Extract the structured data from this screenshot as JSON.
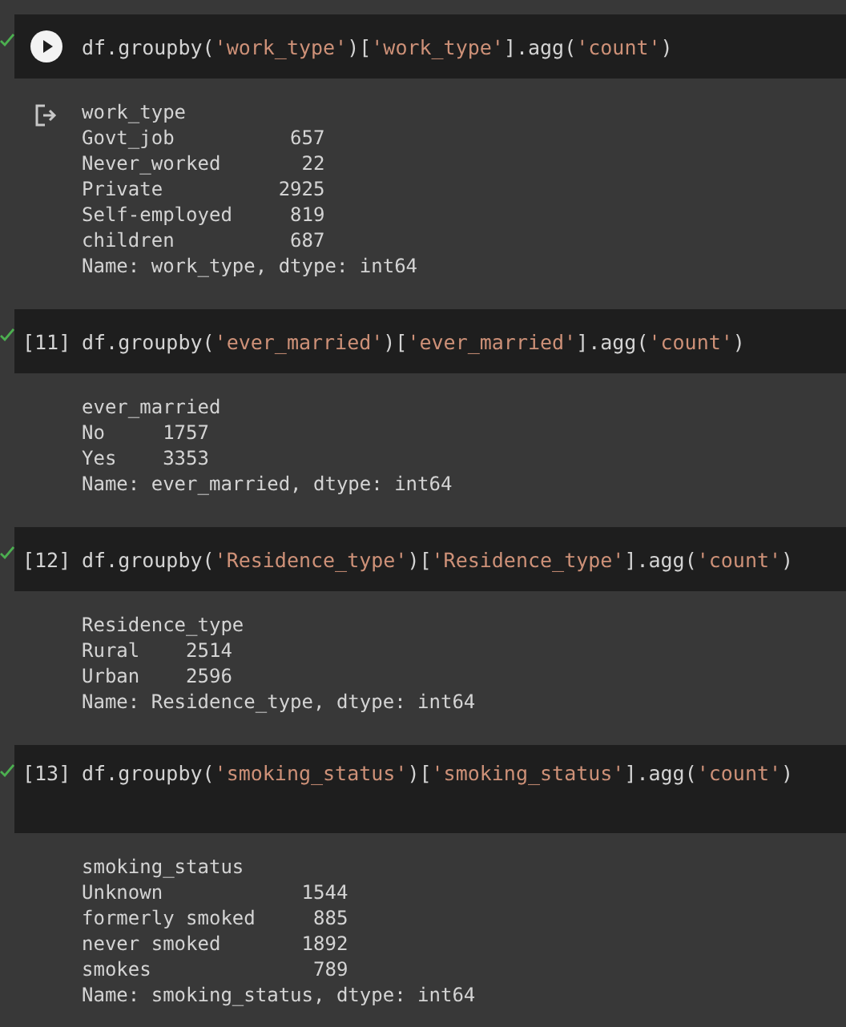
{
  "cells": [
    {
      "kind": "run_button",
      "code": [
        {
          "kind": "plain",
          "text": "df.groupby("
        },
        {
          "kind": "string",
          "text": "'work_type'"
        },
        {
          "kind": "plain",
          "text": ")["
        },
        {
          "kind": "string",
          "text": "'work_type'"
        },
        {
          "kind": "plain",
          "text": "].agg("
        },
        {
          "kind": "string",
          "text": "'count'"
        },
        {
          "kind": "plain",
          "text": ")"
        }
      ],
      "tall": false,
      "output": [
        "work_type",
        "Govt_job          657",
        "Never_worked       22",
        "Private          2925",
        "Self-employed     819",
        "children          687",
        "Name: work_type, dtype: int64"
      ]
    },
    {
      "kind": "count",
      "count": "[11]",
      "code": [
        {
          "kind": "plain",
          "text": "df.groupby("
        },
        {
          "kind": "string",
          "text": "'ever_married'"
        },
        {
          "kind": "plain",
          "text": ")["
        },
        {
          "kind": "string",
          "text": "'ever_married'"
        },
        {
          "kind": "plain",
          "text": "].agg("
        },
        {
          "kind": "string",
          "text": "'count'"
        },
        {
          "kind": "plain",
          "text": ")"
        }
      ],
      "tall": false,
      "output": [
        "ever_married",
        "No     1757",
        "Yes    3353",
        "Name: ever_married, dtype: int64"
      ]
    },
    {
      "kind": "count",
      "count": "[12]",
      "code": [
        {
          "kind": "plain",
          "text": "df.groupby("
        },
        {
          "kind": "string",
          "text": "'Residence_type'"
        },
        {
          "kind": "plain",
          "text": ")["
        },
        {
          "kind": "string",
          "text": "'Residence_type'"
        },
        {
          "kind": "plain",
          "text": "].agg("
        },
        {
          "kind": "string",
          "text": "'count'"
        },
        {
          "kind": "plain",
          "text": ")"
        }
      ],
      "tall": false,
      "output": [
        "Residence_type",
        "Rural    2514",
        "Urban    2596",
        "Name: Residence_type, dtype: int64"
      ]
    },
    {
      "kind": "count",
      "count": "[13]",
      "code": [
        {
          "kind": "plain",
          "text": "df.groupby("
        },
        {
          "kind": "string",
          "text": "'smoking_status'"
        },
        {
          "kind": "plain",
          "text": ")["
        },
        {
          "kind": "string",
          "text": "'smoking_status'"
        },
        {
          "kind": "plain",
          "text": "].agg("
        },
        {
          "kind": "string",
          "text": "'count'"
        },
        {
          "kind": "plain",
          "text": ")"
        }
      ],
      "tall": true,
      "output": [
        "smoking_status",
        "Unknown            1544",
        "formerly smoked     885",
        "never smoked       1892",
        "smokes              789",
        "Name: smoking_status, dtype: int64"
      ]
    }
  ]
}
